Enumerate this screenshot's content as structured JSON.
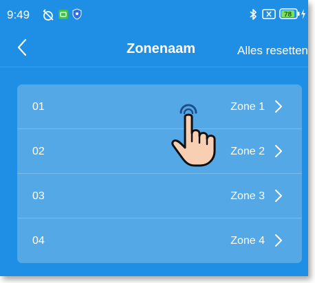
{
  "status_bar": {
    "time": "9:49",
    "battery_level": "78",
    "icons": [
      "alarm-off-icon",
      "app-notification-icon",
      "shield-icon",
      "bluetooth-icon",
      "no-sim-icon",
      "battery-icon",
      "charging-icon"
    ]
  },
  "nav": {
    "title": "Zonenaam",
    "reset_label": "Alles resetten",
    "back_icon": "chevron-left-icon"
  },
  "zones": [
    {
      "number": "01",
      "name": "Zone 1"
    },
    {
      "number": "02",
      "name": "Zone 2"
    },
    {
      "number": "03",
      "name": "Zone 3"
    },
    {
      "number": "04",
      "name": "Zone 4"
    }
  ],
  "colors": {
    "background": "#1f8fe6",
    "card": "#55a8e6",
    "text": "#ffffff",
    "battery": "#7ee05a"
  }
}
